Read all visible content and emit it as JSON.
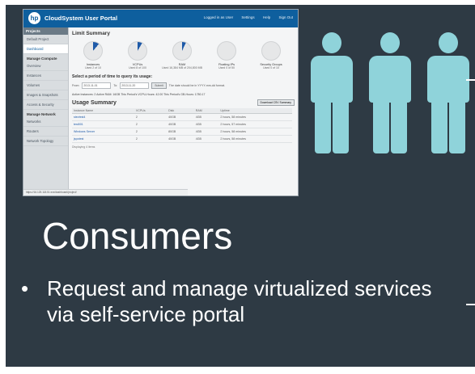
{
  "portal": {
    "logo": "hp",
    "title": "CloudSystem User Portal",
    "top_menu": [
      "Logged in as User",
      "Settings",
      "Help",
      "Sign Out"
    ],
    "sidebar": {
      "header": "Projects",
      "items_top": [
        "Default Project",
        "Dashboard"
      ],
      "group1": "Manage Compute",
      "items_mid": [
        "Overview",
        "Instances",
        "Volumes",
        "Images & Snapshots",
        "Access & Security"
      ],
      "group2": "Manage Network",
      "items_bottom": [
        "Networks",
        "Routers",
        "Network Topology"
      ]
    },
    "limit_summary_title": "Limit Summary",
    "gauges": [
      {
        "name": "Instances",
        "used": "Used 2 of 10"
      },
      {
        "name": "VCPUs",
        "used": "Used 8 of 100"
      },
      {
        "name": "RAM",
        "used": "Used 16,384 MB of 204,800 MB"
      },
      {
        "name": "Floating IPs",
        "used": "Used 0 of 50"
      },
      {
        "name": "Security Groups",
        "used": "Used 0 of 10"
      }
    ],
    "period_title": "Select a period of time to query its usage:",
    "from_label": "From:",
    "from_value": "2013-11-01",
    "to_label": "To:",
    "to_value": "2013-11-20",
    "submit_label": "Submit",
    "date_hint": "The date should be in YYYY-mm-dd format.",
    "active_line": "Active Instances: 2 Active RAM: 16GB This Period's VCPU-Hours: 42.00 This Period's GB-Hours: 1780.17",
    "usage_title": "Usage Summary",
    "download_label": "Download CSV Summary",
    "table_headers": [
      "Instance Name",
      "VCPUs",
      "Disk",
      "RAM",
      "Uptime"
    ],
    "table_rows": [
      [
        "stevtest4",
        "2",
        "40GB",
        "4GB",
        "2 hours, 58 minutes"
      ],
      [
        "test001",
        "2",
        "40GB",
        "4GB",
        "2 hours, 57 minutes"
      ],
      [
        "Windows Server",
        "2",
        "80GB",
        "4GB",
        "2 hours, 58 minutes"
      ],
      [
        "jspotest",
        "2",
        "40GB",
        "4GB",
        "2 hours, 58 minutes"
      ]
    ],
    "displaying": "Displaying 4 items",
    "status_url": "https://16.125.118.51:xxx/dashboard/project/"
  },
  "slide": {
    "title": "Consumers",
    "bullet": "Request and manage virtualized services via self-service portal",
    "bullet_symbol": "•",
    "accent_color": "#8fd3da",
    "background_color": "#2e3a44"
  }
}
